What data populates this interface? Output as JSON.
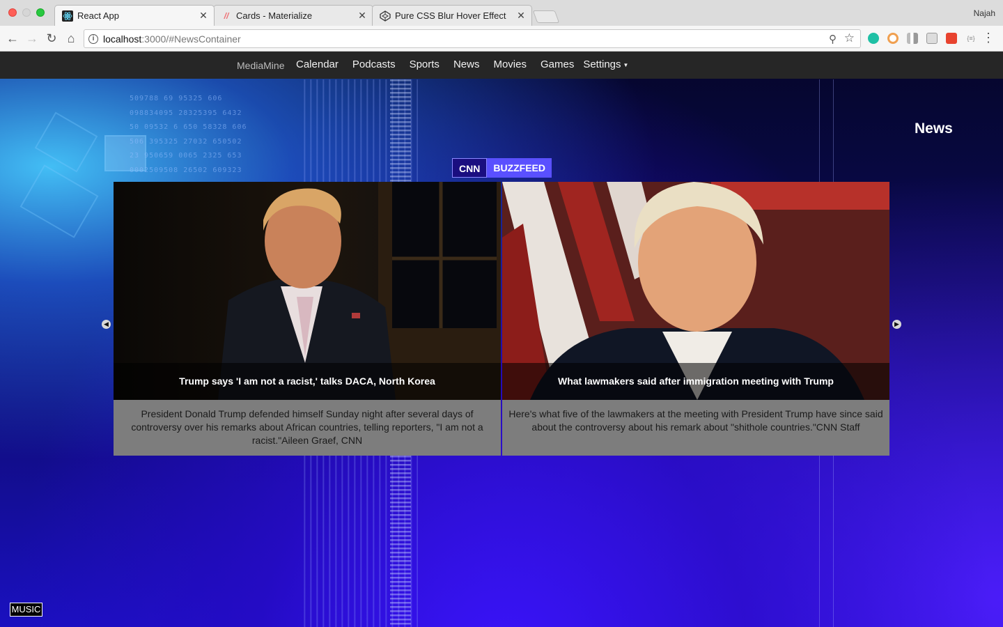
{
  "browser": {
    "tabs": [
      {
        "title": "React App",
        "icon": "react-icon",
        "active": true
      },
      {
        "title": "Cards - Materialize",
        "icon": "materialize-icon",
        "active": false
      },
      {
        "title": "Pure CSS Blur Hover Effect",
        "icon": "codepen-icon",
        "active": false
      }
    ],
    "profile": "Najah",
    "url_host": "localhost",
    "url_rest": ":3000/#NewsContainer"
  },
  "nav": {
    "brand": "MediaMine",
    "links": [
      "Calendar",
      "Podcasts",
      "Sports",
      "News",
      "Movies",
      "Games"
    ],
    "settings": "Settings"
  },
  "section_title": "News",
  "source_tabs": [
    "CNN",
    "BUZZFEED"
  ],
  "articles": [
    {
      "title": "Trump says 'I am not a racist,' talks DACA, North Korea",
      "description": "President Donald Trump defended himself Sunday night after several days of controversy over his remarks about African countries, telling reporters, \"I am not a racist.\"Aileen Graef, CNN"
    },
    {
      "title": "What lawmakers said after immigration meeting with Trump",
      "description": "Here's what five of the lawmakers at the meeting with President Trump have since said about the controversy about his remark about \"shithole countries.\"CNN Staff"
    }
  ],
  "music_button": "MUSIC",
  "background_numbers": [
    "509788 69  95325 606",
    "098834095 28325395 6432",
    "50 09532 6 650 58328 606",
    "506 395325 27032 650502",
    "23 950659 0065 2325 653",
    "0002509508 26502 609323"
  ],
  "colors": {
    "navbar": "#262626",
    "cnn_tab": "#1a0e80",
    "buzzfeed_tab": "#5a50ff",
    "description_bg": "#7d7d7d"
  }
}
